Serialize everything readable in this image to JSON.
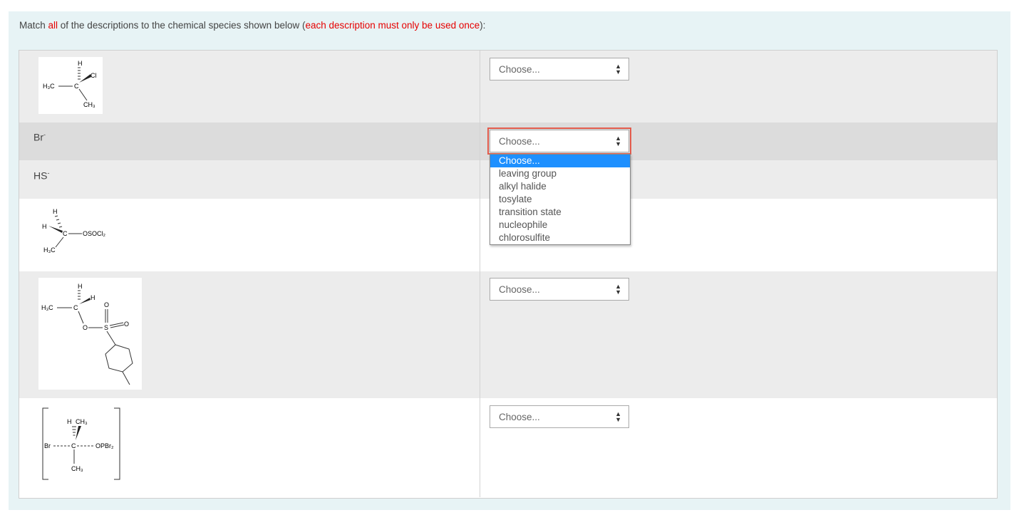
{
  "instruction": {
    "part1": "Match ",
    "all": "all",
    "part2": " of the descriptions to the chemical species shown below (",
    "emphasis": "each description must only be used once",
    "part3": "):"
  },
  "rows": [
    {
      "stem_type": "image",
      "molecule": "2-chloropropane",
      "labels": {
        "h": "H",
        "cl": "Cl",
        "h3c": "H₃C",
        "c": "C",
        "ch3": "CH₃"
      },
      "select": "Choose..."
    },
    {
      "stem_type": "text",
      "stem": "Br",
      "charge": "-",
      "select": "Choose..."
    },
    {
      "stem_type": "text",
      "stem": "HS",
      "charge": "-",
      "select": ""
    },
    {
      "stem_type": "image",
      "molecule": "alkyl chlorosulfite",
      "labels": {
        "h_top": "H",
        "h_left": "H",
        "c": "C",
        "group": "OSOCl₂",
        "h3c": "H₃C"
      },
      "select": ""
    },
    {
      "stem_type": "image",
      "molecule": "alkyl tosylate",
      "labels": {
        "h_top": "H",
        "h_right": "H",
        "h3c": "H₃C",
        "c": "C",
        "o1": "O",
        "o2": "O",
        "s": "S",
        "o3": "O"
      },
      "select": "Choose..."
    },
    {
      "stem_type": "image",
      "molecule": "SN2 transition state",
      "labels": {
        "h": "H",
        "ch3_top": "CH₃",
        "br": "Br",
        "c": "C",
        "group": "OPBr₂",
        "ch3_bottom": "CH₃"
      },
      "select": "Choose..."
    }
  ],
  "dropdown": {
    "open": true,
    "options": [
      "Choose...",
      "leaving group",
      "alkyl halide",
      "tosylate",
      "transition state",
      "nucleophile",
      "chlorosulfite"
    ],
    "selected": "Choose..."
  },
  "colors": {
    "accent_red": "#e60000",
    "focus_outline": "#e25b4c",
    "highlight": "#1e90ff",
    "panel_bg": "#e7f3f5"
  }
}
